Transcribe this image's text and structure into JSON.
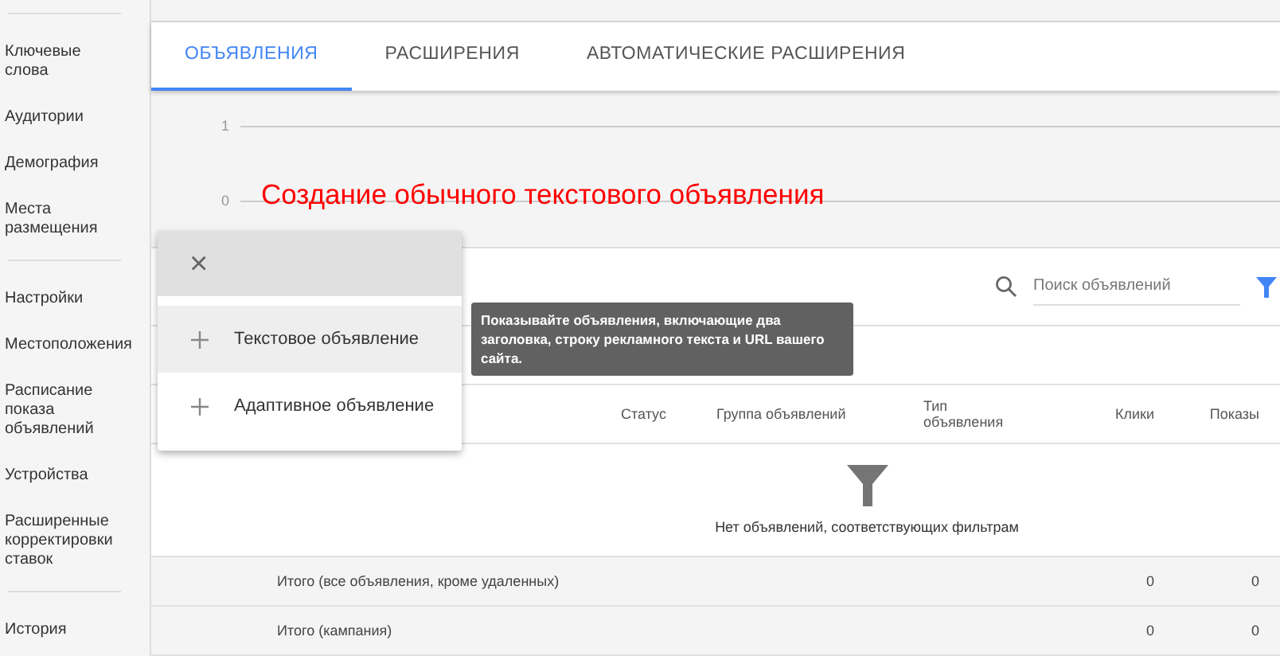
{
  "sidebar": {
    "sections": [
      {
        "items": [
          "Ключевые слова",
          "Аудитории",
          "Демография",
          "Места размещения"
        ]
      },
      {
        "items": [
          "Настройки",
          "Местоположения",
          "Расписание показа объявлений",
          "Устройства",
          "Расширенные корректировки ставок"
        ]
      },
      {
        "items": [
          "История"
        ]
      }
    ]
  },
  "tabs": [
    {
      "label": "ОБЪЯВЛЕНИЯ",
      "selected": true
    },
    {
      "label": "РАСШИРЕНИЯ",
      "selected": false
    },
    {
      "label": "АВТОМАТИЧЕСКИЕ РАСШИРЕНИЯ",
      "selected": false
    }
  ],
  "chart": {
    "y_labels": [
      "1",
      "0"
    ]
  },
  "annotation": "Создание обычного текстового объявления",
  "search": {
    "placeholder": "Поиск объявлений"
  },
  "table": {
    "columns": [
      "",
      "Статус",
      "Группа объявлений",
      "Тип объявления",
      "Клики",
      "Показы"
    ],
    "empty_message": "Нет объявлений, соответствующих фильтрам",
    "totals": [
      {
        "label": "Итого (все объявления, кроме удаленных)",
        "clicks": "0",
        "impressions": "0"
      },
      {
        "label": "Итого (кампания)",
        "clicks": "0",
        "impressions": "0"
      }
    ]
  },
  "create_menu": {
    "close": "×",
    "items": [
      {
        "label": "Текстовое объявление",
        "selected": true
      },
      {
        "label": "Адаптивное объявление",
        "selected": false
      }
    ]
  },
  "tooltip": "Показывайте объявления, включающие два заголовка, строку рекламного текста и URL вашего сайта."
}
